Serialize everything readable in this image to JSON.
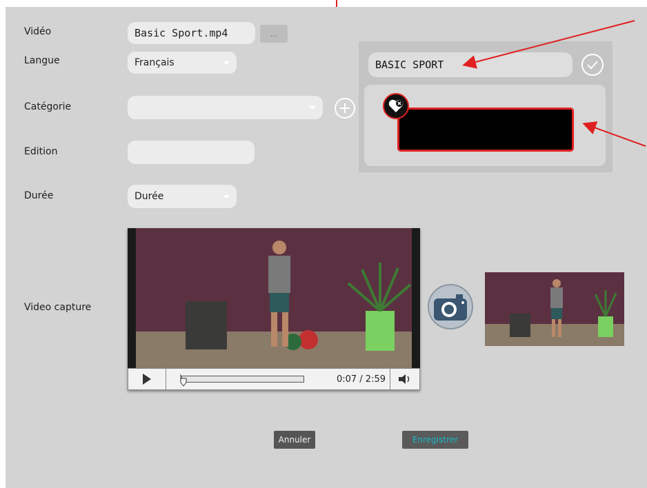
{
  "form": {
    "video_label": "Vidéo",
    "video_value": "Basic Sport.mp4",
    "browse_label": "...",
    "langue_label": "Langue",
    "langue_value": "Français",
    "categorie_label": "Catégorie",
    "categorie_value": "",
    "edition_label": "Edition",
    "edition_value": "",
    "duree_label": "Durée",
    "duree_value": "Durée",
    "capture_label": "Video capture"
  },
  "popup": {
    "title_value": "BASIC SPORT"
  },
  "player": {
    "time": "0:07 / 2:59",
    "progress_fraction": 0.04
  },
  "actions": {
    "cancel_label": "Annuler",
    "save_label": "Enregistrer"
  },
  "colors": {
    "panel_bg": "#d3d3d3",
    "field_bg": "#ececec",
    "accent_red": "#e02020",
    "camera_blue": "#3a5670",
    "save_text": "#19b8c8"
  },
  "icons": {
    "browse": "ellipsis-icon",
    "add": "plus-circle-icon",
    "confirm": "check-circle-icon",
    "badge": "heart-remove-icon",
    "play": "play-icon",
    "volume": "volume-icon",
    "camera": "camera-icon"
  }
}
